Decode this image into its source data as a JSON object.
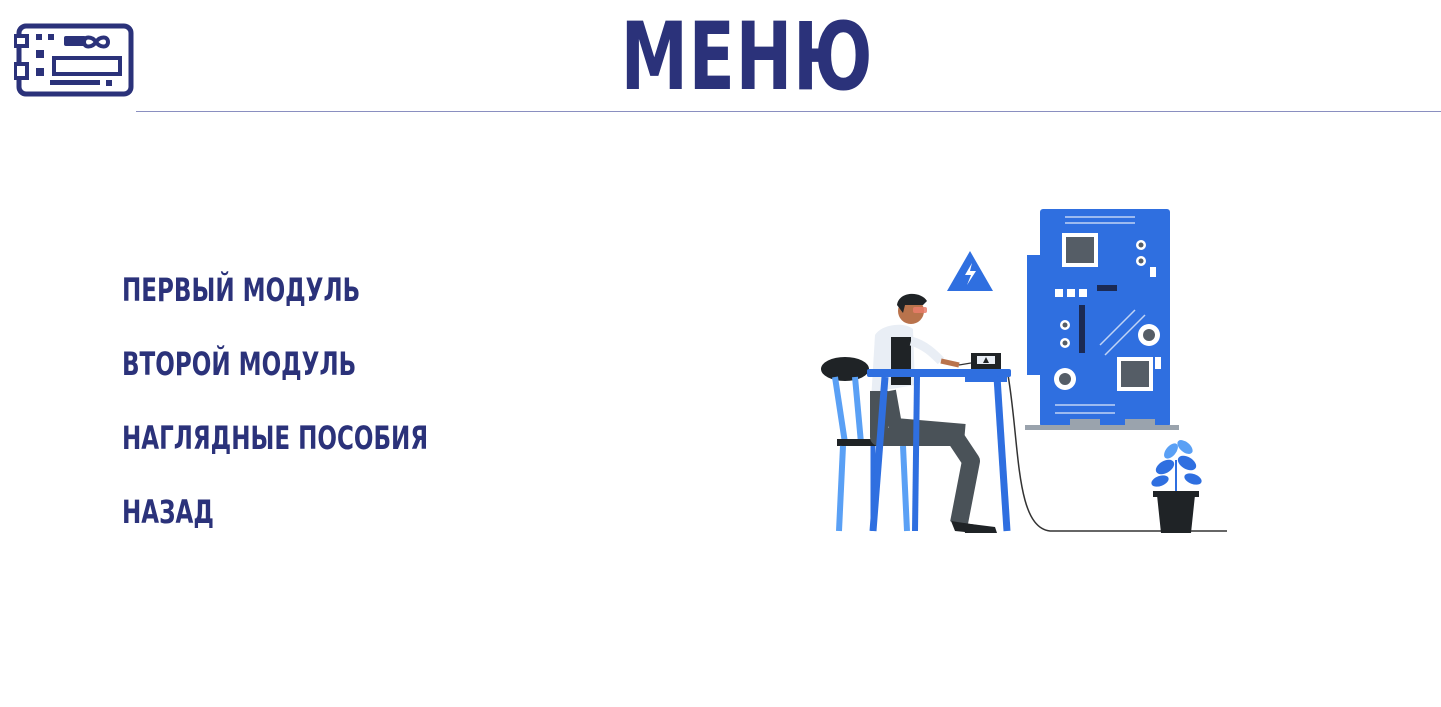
{
  "header": {
    "title": "МЕНЮ",
    "logo_icon": "arduino-board-icon"
  },
  "menu": {
    "items": [
      {
        "label": "ПЕРВЫЙ МОДУЛЬ"
      },
      {
        "label": "ВТОРОЙ МОДУЛЬ"
      },
      {
        "label": "НАГЛЯДНЫЕ ПОСОБИЯ"
      },
      {
        "label": "НАЗАД"
      }
    ]
  },
  "illustration": {
    "icon": "engineer-with-circuit-board-illustration"
  },
  "colors": {
    "primary": "#2b327a",
    "accent_blue": "#2f6fe0",
    "divider": "#8a8fc0"
  }
}
